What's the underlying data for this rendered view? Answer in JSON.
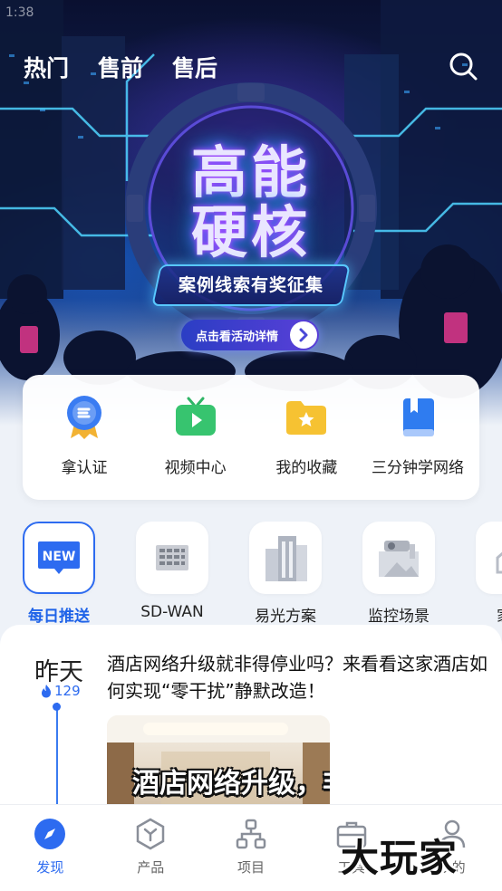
{
  "status_bar": {
    "time": "1:38"
  },
  "top_tabs": [
    {
      "label": "热门"
    },
    {
      "label": "售前"
    },
    {
      "label": "售后"
    }
  ],
  "banner": {
    "title_line1": "高能",
    "title_line2": "硬核",
    "subtitle": "案例线索有奖征集",
    "cta": "点击看活动详情"
  },
  "quick_actions": [
    {
      "label": "拿认证",
      "icon": "certificate-badge-icon"
    },
    {
      "label": "视频中心",
      "icon": "tv-play-icon"
    },
    {
      "label": "我的收藏",
      "icon": "star-folder-icon"
    },
    {
      "label": "三分钟学网络",
      "icon": "book-icon"
    }
  ],
  "categories": [
    {
      "label": "每日推送",
      "badge": "NEW",
      "active": true
    },
    {
      "label": "SD-WAN",
      "active": false
    },
    {
      "label": "易光方案",
      "active": false
    },
    {
      "label": "监控场景",
      "active": false
    },
    {
      "label": "家居",
      "active": false
    }
  ],
  "feed": {
    "date": "昨天",
    "heat": "129",
    "post_title": "酒店网络升级就非得停业吗？来看看这家酒店如何实现“零干扰”静默改造！",
    "thumb_text": "酒店网络升级，非得停业？"
  },
  "bottom_nav": [
    {
      "label": "发现",
      "icon": "compass-icon",
      "active": true
    },
    {
      "label": "产品",
      "icon": "hexagon-product-icon",
      "active": false
    },
    {
      "label": "项目",
      "icon": "org-chart-icon",
      "active": false
    },
    {
      "label": "工具",
      "icon": "toolbox-icon",
      "active": false
    },
    {
      "label": "我的",
      "icon": "user-icon",
      "active": false
    }
  ],
  "watermark": "大玩家",
  "colors": {
    "accent": "#2d6bf0",
    "banner_glow": "#b04dff"
  }
}
